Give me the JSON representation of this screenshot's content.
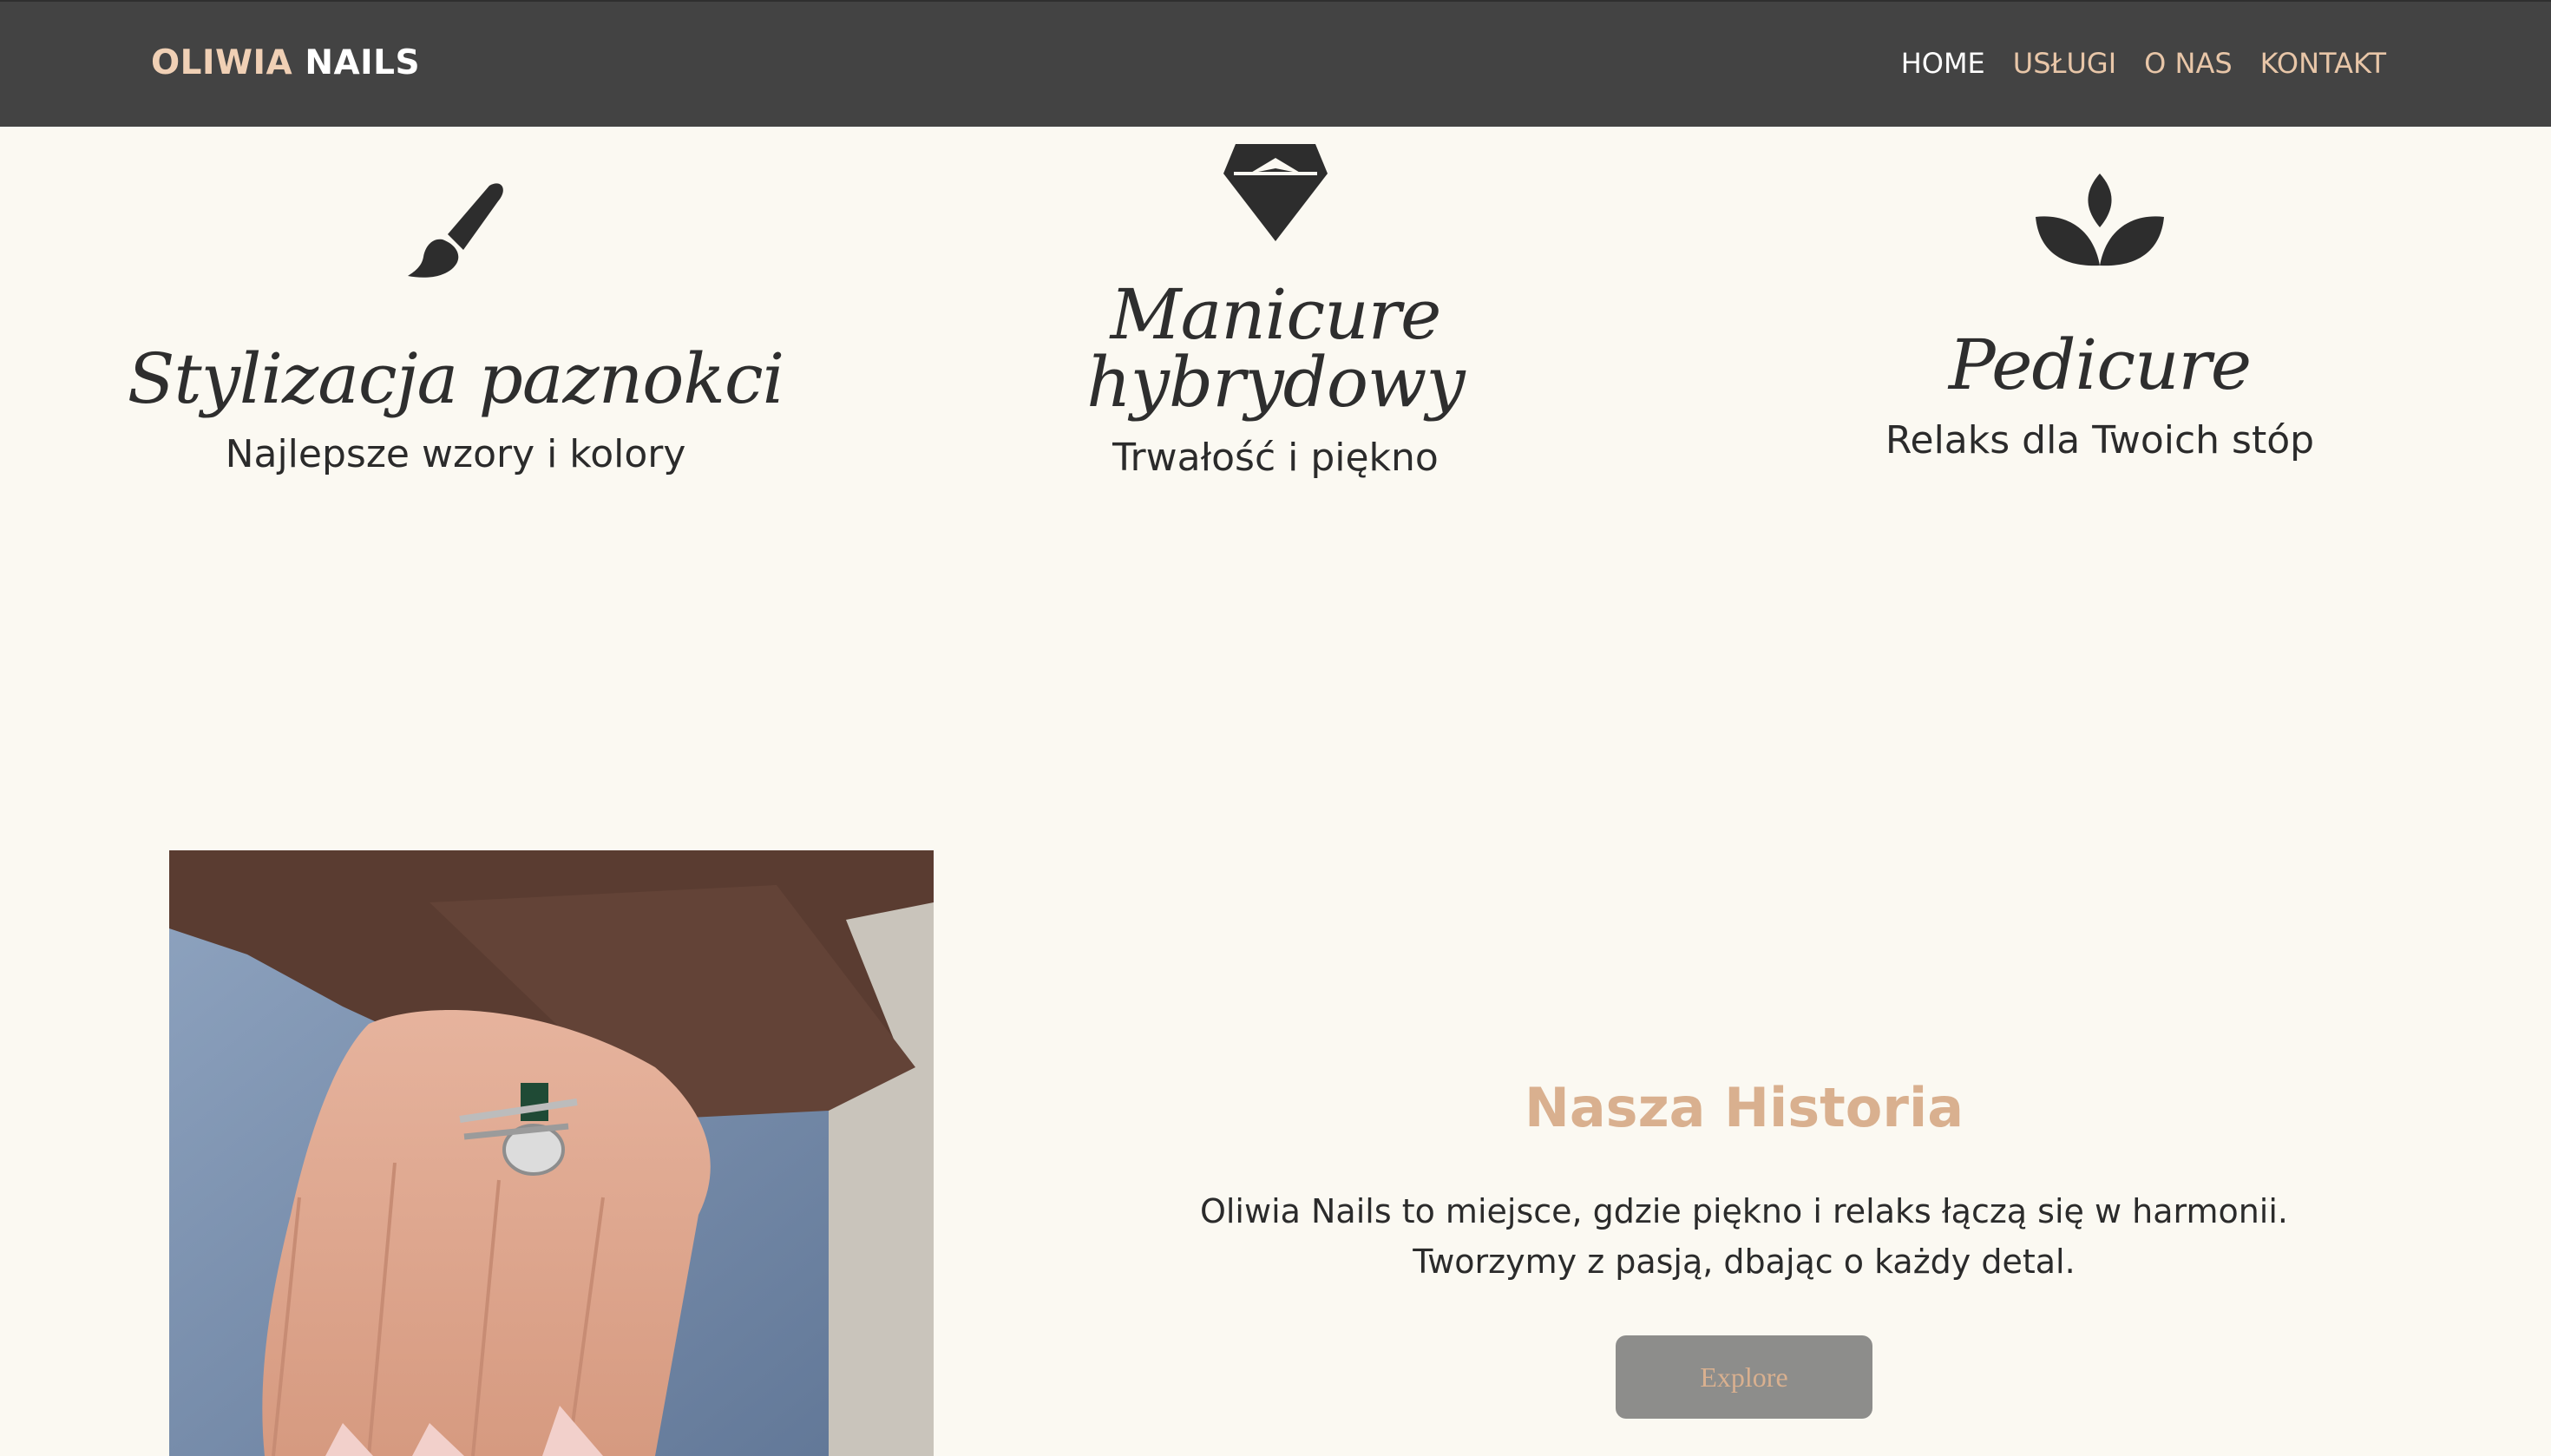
{
  "brand": {
    "part1": "OLIWIA",
    "part2": "NAILS",
    "accent_color": "#f0d0b5"
  },
  "nav": {
    "items": [
      {
        "label": "HOME",
        "active": true
      },
      {
        "label": "USŁUGI",
        "active": false
      },
      {
        "label": "O NAS",
        "active": false
      },
      {
        "label": "KONTAKT",
        "active": false
      }
    ]
  },
  "features": [
    {
      "icon": "paintbrush-icon",
      "title": "Stylizacja paznokci",
      "subtitle": "Najlepsze wzory i kolory"
    },
    {
      "icon": "diamond-icon",
      "title_line1": "Manicure",
      "title_line2": "hybrydowy",
      "subtitle": "Trwałość i piękno"
    },
    {
      "icon": "lotus-icon",
      "title": "Pedicure",
      "subtitle": "Relaks dla Twoich stóp"
    }
  ],
  "story": {
    "title": "Nasza Historia",
    "text": "Oliwia Nails to miejsce, gdzie piękno i relaks łączą się w harmonii. Tworzymy z pasją, dbając o każdy detal.",
    "button_label": "Explore"
  },
  "colors": {
    "navbar_bg": "#434343",
    "page_bg": "#fbf9f2",
    "accent": "#d9b08f",
    "button_bg": "#8d8d8b"
  }
}
